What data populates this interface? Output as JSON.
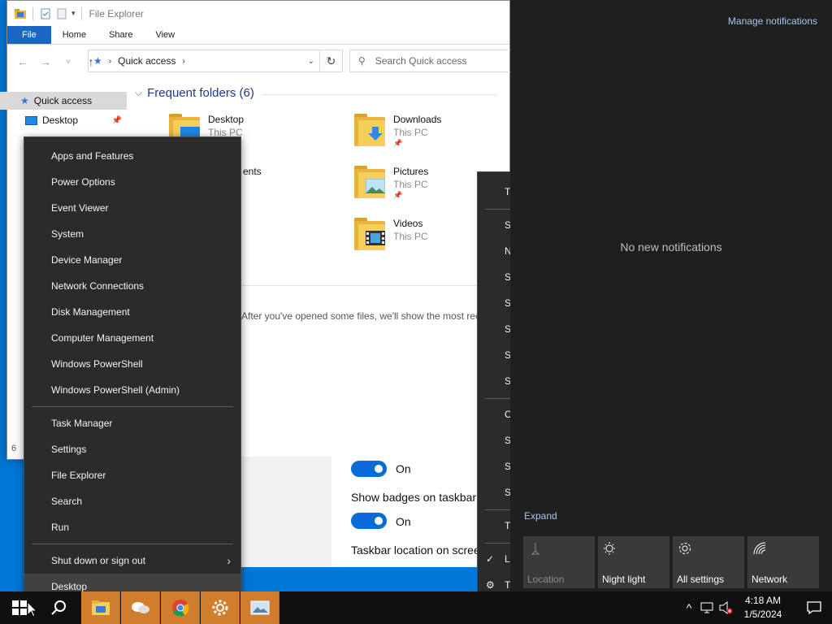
{
  "explorer": {
    "title": "File Explorer",
    "tabs": [
      "File",
      "Home",
      "Share",
      "View"
    ],
    "address": "Quick access",
    "search_placeholder": "Search Quick access",
    "nav": {
      "quick_access": "Quick access",
      "desktop": "Desktop"
    },
    "section_title": "Frequent folders (6)",
    "folders": [
      {
        "name": "Desktop",
        "location": "This PC"
      },
      {
        "name": "Downloads",
        "location": "This PC"
      },
      {
        "name": "ents",
        "location": ""
      },
      {
        "name": "Pictures",
        "location": "This PC"
      },
      {
        "name": "Videos",
        "location": "This PC"
      }
    ],
    "recent_text": "After you've opened some files, we'll show the most rec",
    "status_fragment": "6"
  },
  "settings": {
    "toggle1_label": "On",
    "badges_label": "Show badges on taskbar",
    "toggle2_label": "On",
    "location_label": "Taskbar location on scree"
  },
  "winx_menu": {
    "group1": [
      "Apps and Features",
      "Power Options",
      "Event Viewer",
      "System",
      "Device Manager",
      "Network Connections",
      "Disk Management",
      "Computer Management",
      "Windows PowerShell",
      "Windows PowerShell (Admin)"
    ],
    "group2": [
      "Task Manager",
      "Settings",
      "File Explorer",
      "Search",
      "Run"
    ],
    "group3": [
      "Shut down or sign out",
      "Desktop"
    ]
  },
  "context_menu": {
    "items": [
      "T",
      "S",
      "N",
      "S",
      "S",
      "S",
      "S",
      "S",
      "C",
      "S",
      "S",
      "S",
      "T",
      "L",
      "T"
    ]
  },
  "action_center": {
    "manage": "Manage notifications",
    "empty": "No new notifications",
    "expand": "Expand",
    "tiles": [
      "Location",
      "Night light",
      "All settings",
      "Network"
    ]
  },
  "clock": {
    "time": "4:18 AM",
    "date": "1/5/2024"
  },
  "colors": {
    "accent": "#0078d7",
    "toggle": "#0a6cd8",
    "taskbar_app": "#d17d2e"
  }
}
